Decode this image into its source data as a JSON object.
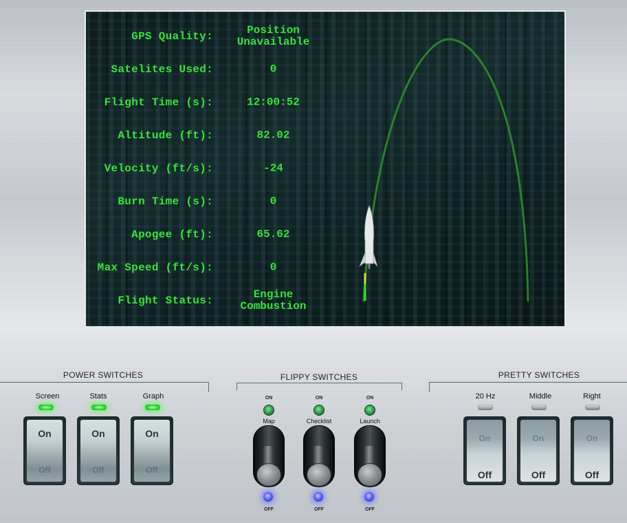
{
  "stats": [
    {
      "label": "GPS Quality:",
      "value": "Position\nUnavailable"
    },
    {
      "label": "Satelites Used:",
      "value": "0"
    },
    {
      "label": "Flight Time (s):",
      "value": "12:00:52"
    },
    {
      "label": "Altitude (ft):",
      "value": "82.02"
    },
    {
      "label": "Velocity (ft/s):",
      "value": "-24"
    },
    {
      "label": "Burn Time (s):",
      "value": "0"
    },
    {
      "label": "Apogee (ft):",
      "value": "65.62"
    },
    {
      "label": "Max Speed (ft/s):",
      "value": "0"
    },
    {
      "label": "Flight Status:",
      "value": "Engine\nCombustion"
    }
  ],
  "power": {
    "title": "POWER SWITCHES",
    "switches": [
      {
        "label": "Screen",
        "on": "On",
        "off": "Off",
        "state": "on"
      },
      {
        "label": "Stats",
        "on": "On",
        "off": "Off",
        "state": "on"
      },
      {
        "label": "Graph",
        "on": "On",
        "off": "Off",
        "state": "on"
      }
    ]
  },
  "flippy": {
    "title": "FLIPPY SWITCHES",
    "switches": [
      {
        "label": "Map",
        "on": "ON",
        "off": "OFF",
        "state": "off"
      },
      {
        "label": "Checklist",
        "on": "ON",
        "off": "OFF",
        "state": "off"
      },
      {
        "label": "Launch",
        "on": "ON",
        "off": "OFF",
        "state": "off"
      }
    ]
  },
  "pretty": {
    "title": "PRETTY SWITCHES",
    "switches": [
      {
        "label": "20 Hz",
        "on": "On",
        "off": "Off",
        "state": "off"
      },
      {
        "label": "Middle",
        "on": "On",
        "off": "Off",
        "state": "off"
      },
      {
        "label": "Right",
        "on": "On",
        "off": "Off",
        "state": "off"
      }
    ]
  },
  "colors": {
    "stat_text": "#3ce23c",
    "trajectory": "#2f8a2f",
    "led_on": "#3fe23f",
    "led_blue": "#5c63f4"
  },
  "icons": {
    "rocket": "rocket-icon"
  }
}
